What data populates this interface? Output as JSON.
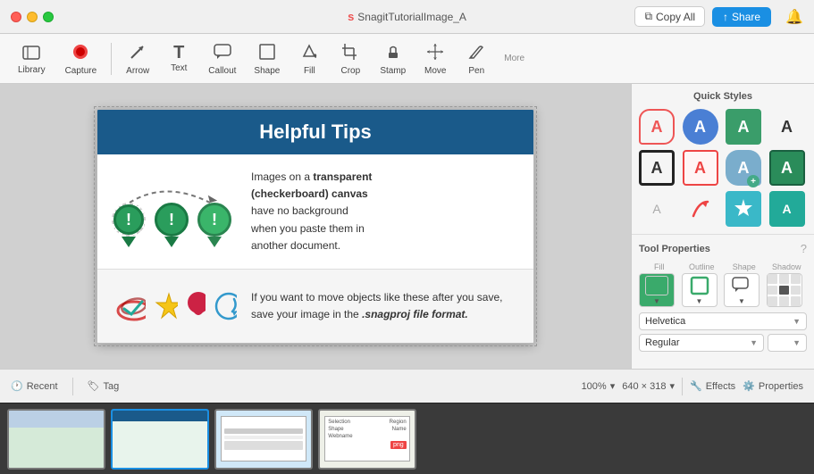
{
  "window": {
    "title": "SnagitTutorialImage_A",
    "title_prefix": "s"
  },
  "traffic_lights": {
    "red": "close",
    "yellow": "minimize",
    "green": "maximize"
  },
  "header_buttons": {
    "copy_all": "Copy All",
    "share": "Share"
  },
  "toolbar": {
    "items": [
      {
        "id": "library",
        "label": "Library",
        "icon": "📚"
      },
      {
        "id": "capture",
        "label": "Capture",
        "icon": "⏺"
      },
      {
        "id": "arrow",
        "label": "Arrow",
        "icon": "↗"
      },
      {
        "id": "text",
        "label": "Text",
        "icon": "T"
      },
      {
        "id": "callout",
        "label": "Callout",
        "icon": "💬"
      },
      {
        "id": "shape",
        "label": "Shape",
        "icon": "□"
      },
      {
        "id": "fill",
        "label": "Fill",
        "icon": "🪣"
      },
      {
        "id": "crop",
        "label": "Crop",
        "icon": "⊠"
      },
      {
        "id": "stamp",
        "label": "Stamp",
        "icon": "✦"
      },
      {
        "id": "move",
        "label": "Move",
        "icon": "✥"
      },
      {
        "id": "pen",
        "label": "Pen",
        "icon": "✏"
      },
      {
        "id": "more",
        "label": "More",
        "icon": "…"
      }
    ]
  },
  "canvas": {
    "title": "Helpful Tips",
    "row1_text": "Images on a transparent (checkerboard) canvas have no background when you paste them in another document.",
    "row2_text_before": "If you want to move objects like these after you save, save your image in the",
    "row2_text_bold": ".snagproj file format.",
    "zoom": "100%",
    "dimensions": "640 × 318"
  },
  "quick_styles": {
    "title": "Quick Styles",
    "items": [
      {
        "id": "chat-red",
        "type": "chat-red"
      },
      {
        "id": "blue-filled",
        "type": "blue-filled"
      },
      {
        "id": "green-sq",
        "type": "green-sq"
      },
      {
        "id": "plain",
        "type": "plain"
      },
      {
        "id": "black-border",
        "type": "black-border"
      },
      {
        "id": "red-border",
        "type": "red-border"
      },
      {
        "id": "cloud-blue",
        "type": "cloud-blue"
      },
      {
        "id": "green-dark",
        "type": "green-dark"
      },
      {
        "id": "plain-small",
        "type": "plain-small"
      },
      {
        "id": "red-arrow",
        "type": "red-arrow"
      },
      {
        "id": "teal-star",
        "type": "teal-star"
      }
    ]
  },
  "tool_properties": {
    "title": "Tool Properties",
    "help": "?",
    "tabs": [
      "Fill",
      "Outline",
      "Shape",
      "Shadow"
    ],
    "font": "Helvetica",
    "style": "Regular"
  },
  "status_bar": {
    "recent": "Recent",
    "tag": "Tag",
    "zoom": "100%",
    "dimensions": "640 × 318",
    "effects": "Effects",
    "properties": "Properties"
  },
  "thumbnails": [
    {
      "id": 1,
      "label": "thumb1"
    },
    {
      "id": 2,
      "label": "thumb2"
    },
    {
      "id": 3,
      "label": "thumb3"
    },
    {
      "id": 4,
      "label": "thumb4"
    }
  ]
}
